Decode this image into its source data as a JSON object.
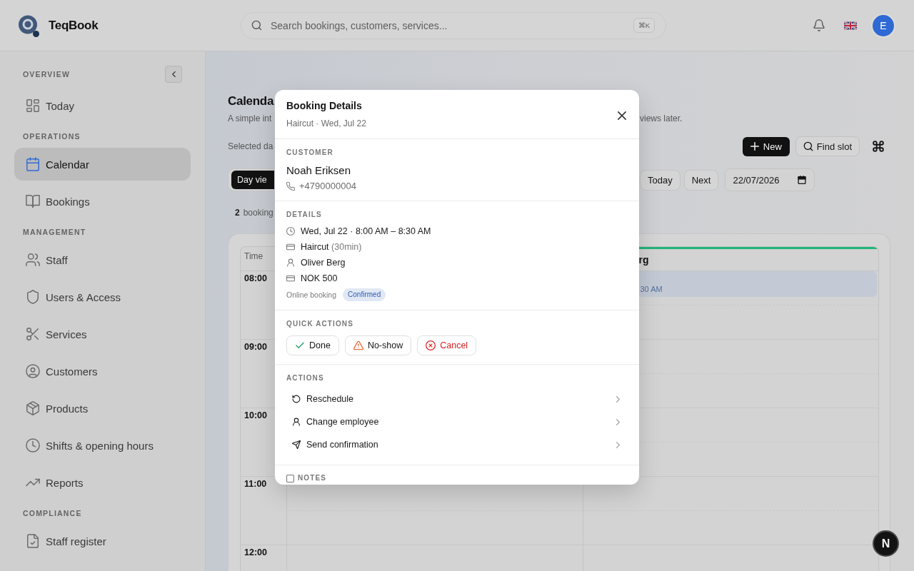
{
  "topbar": {
    "brand": "TeqBook",
    "search": {
      "placeholder": "Search bookings, customers, services...",
      "shortcut": "⌘K"
    },
    "avatar_initial": "E"
  },
  "sidebar": {
    "sections": [
      {
        "title": "OVERVIEW",
        "items": [
          {
            "label": "Today",
            "selected": false
          }
        ]
      },
      {
        "title": "OPERATIONS",
        "items": [
          {
            "label": "Calendar",
            "selected": true
          },
          {
            "label": "Bookings",
            "selected": false
          }
        ]
      },
      {
        "title": "MANAGEMENT",
        "items": [
          {
            "label": "Staff",
            "selected": false
          },
          {
            "label": "Users & Access",
            "selected": false
          },
          {
            "label": "Services",
            "selected": false
          },
          {
            "label": "Customers",
            "selected": false
          },
          {
            "label": "Products",
            "selected": false
          },
          {
            "label": "Shifts & opening hours",
            "selected": false
          },
          {
            "label": "Reports",
            "selected": false
          }
        ]
      },
      {
        "title": "COMPLIANCE",
        "items": [
          {
            "label": "Staff register",
            "selected": false
          }
        ]
      }
    ]
  },
  "page": {
    "title": "Calenda",
    "subtitle_parts": [
      "A simple int",
      "views later."
    ],
    "selected_date_text": "Selected da",
    "new_button": "New",
    "find_slot_button": "Find slot",
    "view_tabs": [
      {
        "label": "Day vie",
        "selected": true
      }
    ],
    "nav_buttons": [
      "Today",
      "Next"
    ],
    "date_value": "22/07/2026",
    "booking_count": "2",
    "booking_count_label": "booking"
  },
  "calendar": {
    "time_header": "Time",
    "times": [
      "08:00",
      "09:00",
      "10:00",
      "11:00",
      "12:00"
    ],
    "columns": [
      {
        "header": "rg",
        "color": "#1fb57a",
        "bookings": [
          {
            "time": "30 AM"
          }
        ]
      }
    ]
  },
  "booking_modal": {
    "title": "Booking Details",
    "subtitle": "Haircut · Wed, Jul 22",
    "customer": {
      "heading": "CUSTOMER",
      "name": "Noah Eriksen",
      "phone": "+4790000004"
    },
    "details": {
      "heading": "DETAILS",
      "rows": [
        {
          "text": "Wed, Jul 22 · 8:00 AM – 8:30 AM"
        },
        {
          "text": "Haircut",
          "note": "(30min)"
        },
        {
          "text": "Oliver Berg"
        },
        {
          "text": "NOK 500"
        }
      ],
      "source": "Online booking",
      "status": "Confirmed"
    },
    "quick_actions": {
      "heading": "QUICK ACTIONS",
      "buttons": [
        {
          "label": "Done",
          "kind": "done"
        },
        {
          "label": "No-show",
          "kind": "warning"
        },
        {
          "label": "Cancel",
          "kind": "danger"
        }
      ]
    },
    "actions": {
      "heading": "ACTIONS",
      "items": [
        "Reschedule",
        "Change employee",
        "Send confirmation"
      ]
    },
    "notes": {
      "heading": "NOTES"
    }
  },
  "dev_badge": "N"
}
